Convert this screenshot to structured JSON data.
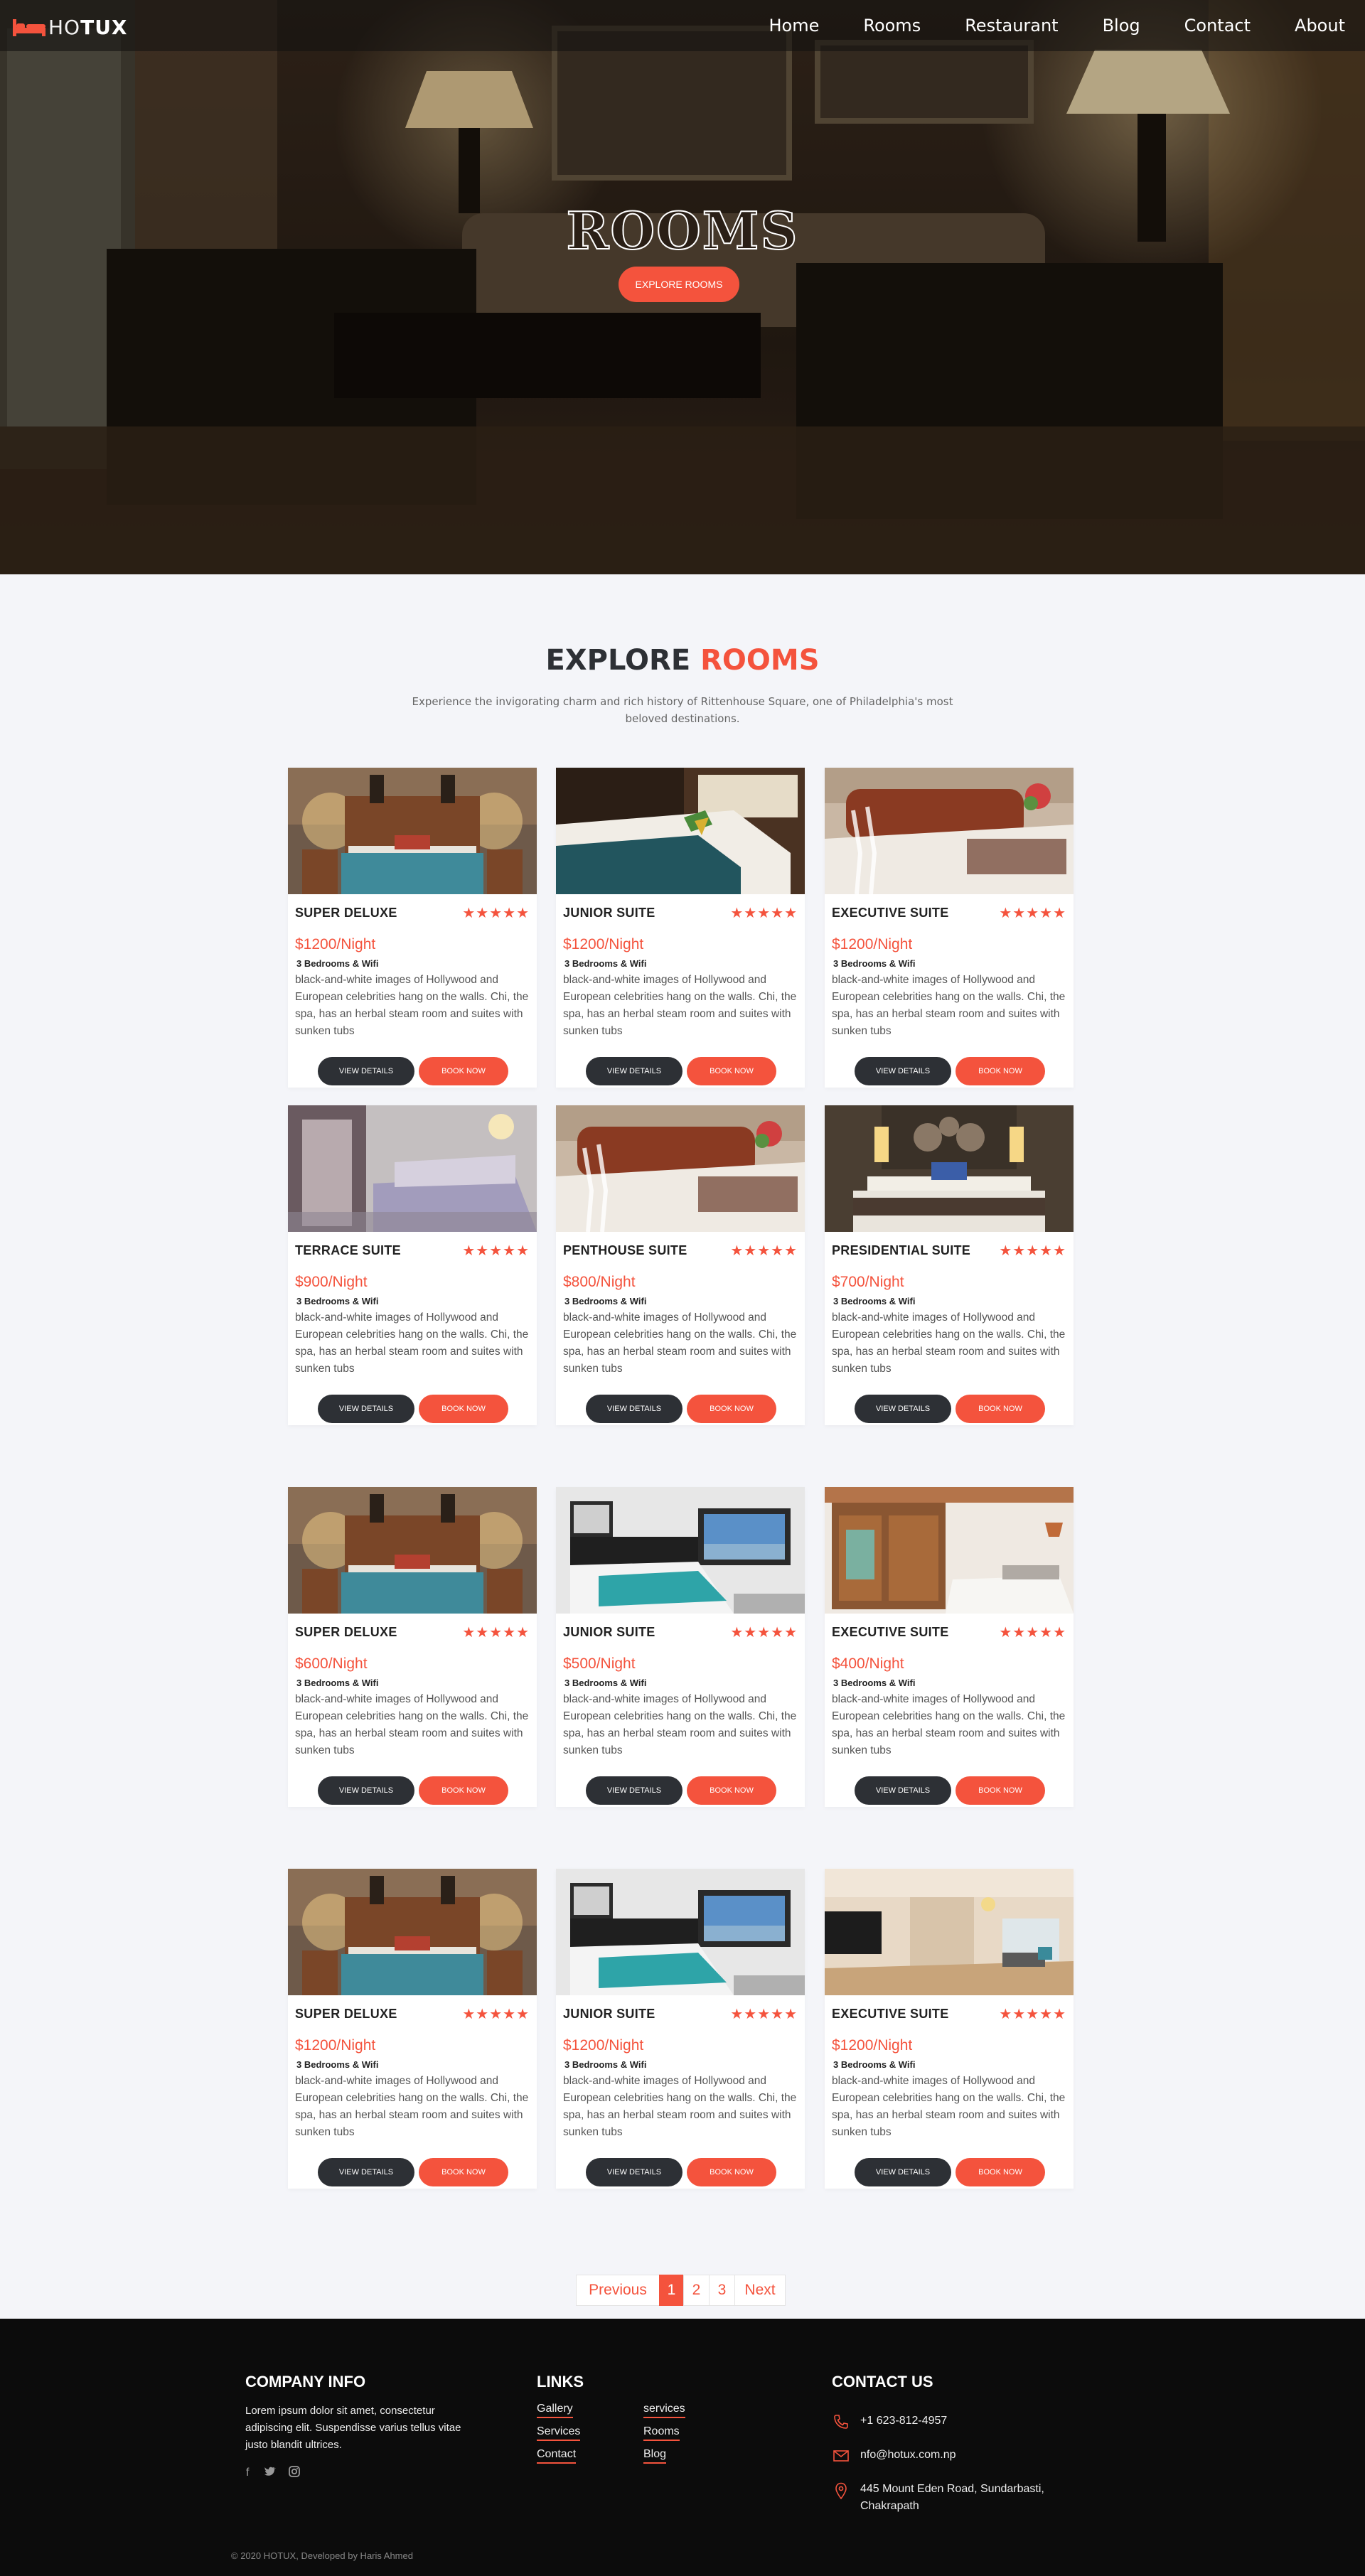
{
  "brand": {
    "logo_prefix": "HO",
    "logo_suffix": "TUX"
  },
  "nav": {
    "items": [
      "Home",
      "Rooms",
      "Restaurant",
      "Blog",
      "Contact",
      "About"
    ]
  },
  "hero": {
    "title": "ROOMS",
    "button": "EXPLORE ROOMS"
  },
  "explore": {
    "title_main": "EXPLORE",
    "title_accent": "ROOMS",
    "description": "Experience the invigorating charm and rich history of Rittenhouse Square, one of Philadelphia's most beloved destinations."
  },
  "rooms": [
    {
      "name": "SUPER DELUXE",
      "price": "$1200/Night",
      "features": "3 Bedrooms & Wifi",
      "rating": 5,
      "image": "bedroom-teal-image"
    },
    {
      "name": "JUNIOR SUITE",
      "price": "$1200/Night",
      "features": "3 Bedrooms & Wifi",
      "rating": 5,
      "image": "bedroom-dark-image"
    },
    {
      "name": "EXECUTIVE SUITE",
      "price": "$1200/Night",
      "features": "3 Bedrooms & Wifi",
      "rating": 5,
      "image": "bedroom-glasses-image"
    },
    {
      "name": "TERRACE SUITE",
      "price": "$900/Night",
      "features": "3 Bedrooms & Wifi",
      "rating": 5,
      "image": "bedroom-purple-image"
    },
    {
      "name": "PENTHOUSE SUITE",
      "price": "$800/Night",
      "features": "3 Bedrooms & Wifi",
      "rating": 5,
      "image": "bedroom-glasses-image"
    },
    {
      "name": "PRESIDENTIAL SUITE",
      "price": "$700/Night",
      "features": "3 Bedrooms & Wifi",
      "rating": 5,
      "image": "bedroom-lamps-image"
    },
    {
      "name": "SUPER DELUXE",
      "price": "$600/Night",
      "features": "3 Bedrooms & Wifi",
      "rating": 5,
      "image": "bedroom-teal-image"
    },
    {
      "name": "JUNIOR SUITE",
      "price": "$500/Night",
      "features": "3 Bedrooms & Wifi",
      "rating": 5,
      "image": "bedroom-window-image"
    },
    {
      "name": "EXECUTIVE SUITE",
      "price": "$400/Night",
      "features": "3 Bedrooms & Wifi",
      "rating": 5,
      "image": "bedroom-wood-image"
    },
    {
      "name": "SUPER DELUXE",
      "price": "$1200/Night",
      "features": "3 Bedrooms & Wifi",
      "rating": 5,
      "image": "bedroom-teal-image"
    },
    {
      "name": "JUNIOR SUITE",
      "price": "$1200/Night",
      "features": "3 Bedrooms & Wifi",
      "rating": 5,
      "image": "bedroom-window-image"
    },
    {
      "name": "EXECUTIVE SUITE",
      "price": "$1200/Night",
      "features": "3 Bedrooms & Wifi",
      "rating": 5,
      "image": "studio-room-image"
    }
  ],
  "room_description": "black-and-white images of Hollywood and European celebrities hang on the walls. Chi, the spa, has an herbal steam room and suites with sunken tubs",
  "room_buttons": {
    "details": "VIEW DETAILS",
    "book": "BOOK NOW"
  },
  "pagination": {
    "previous": "Previous",
    "pages": [
      "1",
      "2",
      "3"
    ],
    "current": "1",
    "next": "Next"
  },
  "footer": {
    "company": {
      "title": "COMPANY INFO",
      "text": "Lorem ipsum dolor sit amet, consectetur adipiscing elit. Suspendisse varius tellus vitae justo blandit ultrices.",
      "social": [
        "facebook-icon",
        "twitter-icon",
        "instagram-icon"
      ]
    },
    "links": {
      "title": "LINKS",
      "col1": [
        "Gallery",
        "Services",
        "Contact"
      ],
      "col2": [
        "services",
        "Rooms",
        "Blog"
      ]
    },
    "contact": {
      "title": "CONTACT US",
      "phone": "+1 623-812-4957",
      "email": "nfo@hotux.com.np",
      "address": "445 Mount Eden Road, Sundarbasti, Chakrapath"
    },
    "copyright": "© 2020 HOTUX, Developed by Haris Ahmed"
  },
  "colors": {
    "accent": "#f4533d",
    "dark": "#2d3035",
    "footer_bg": "#0c0c0c",
    "page_bg": "#f4f5f9"
  }
}
